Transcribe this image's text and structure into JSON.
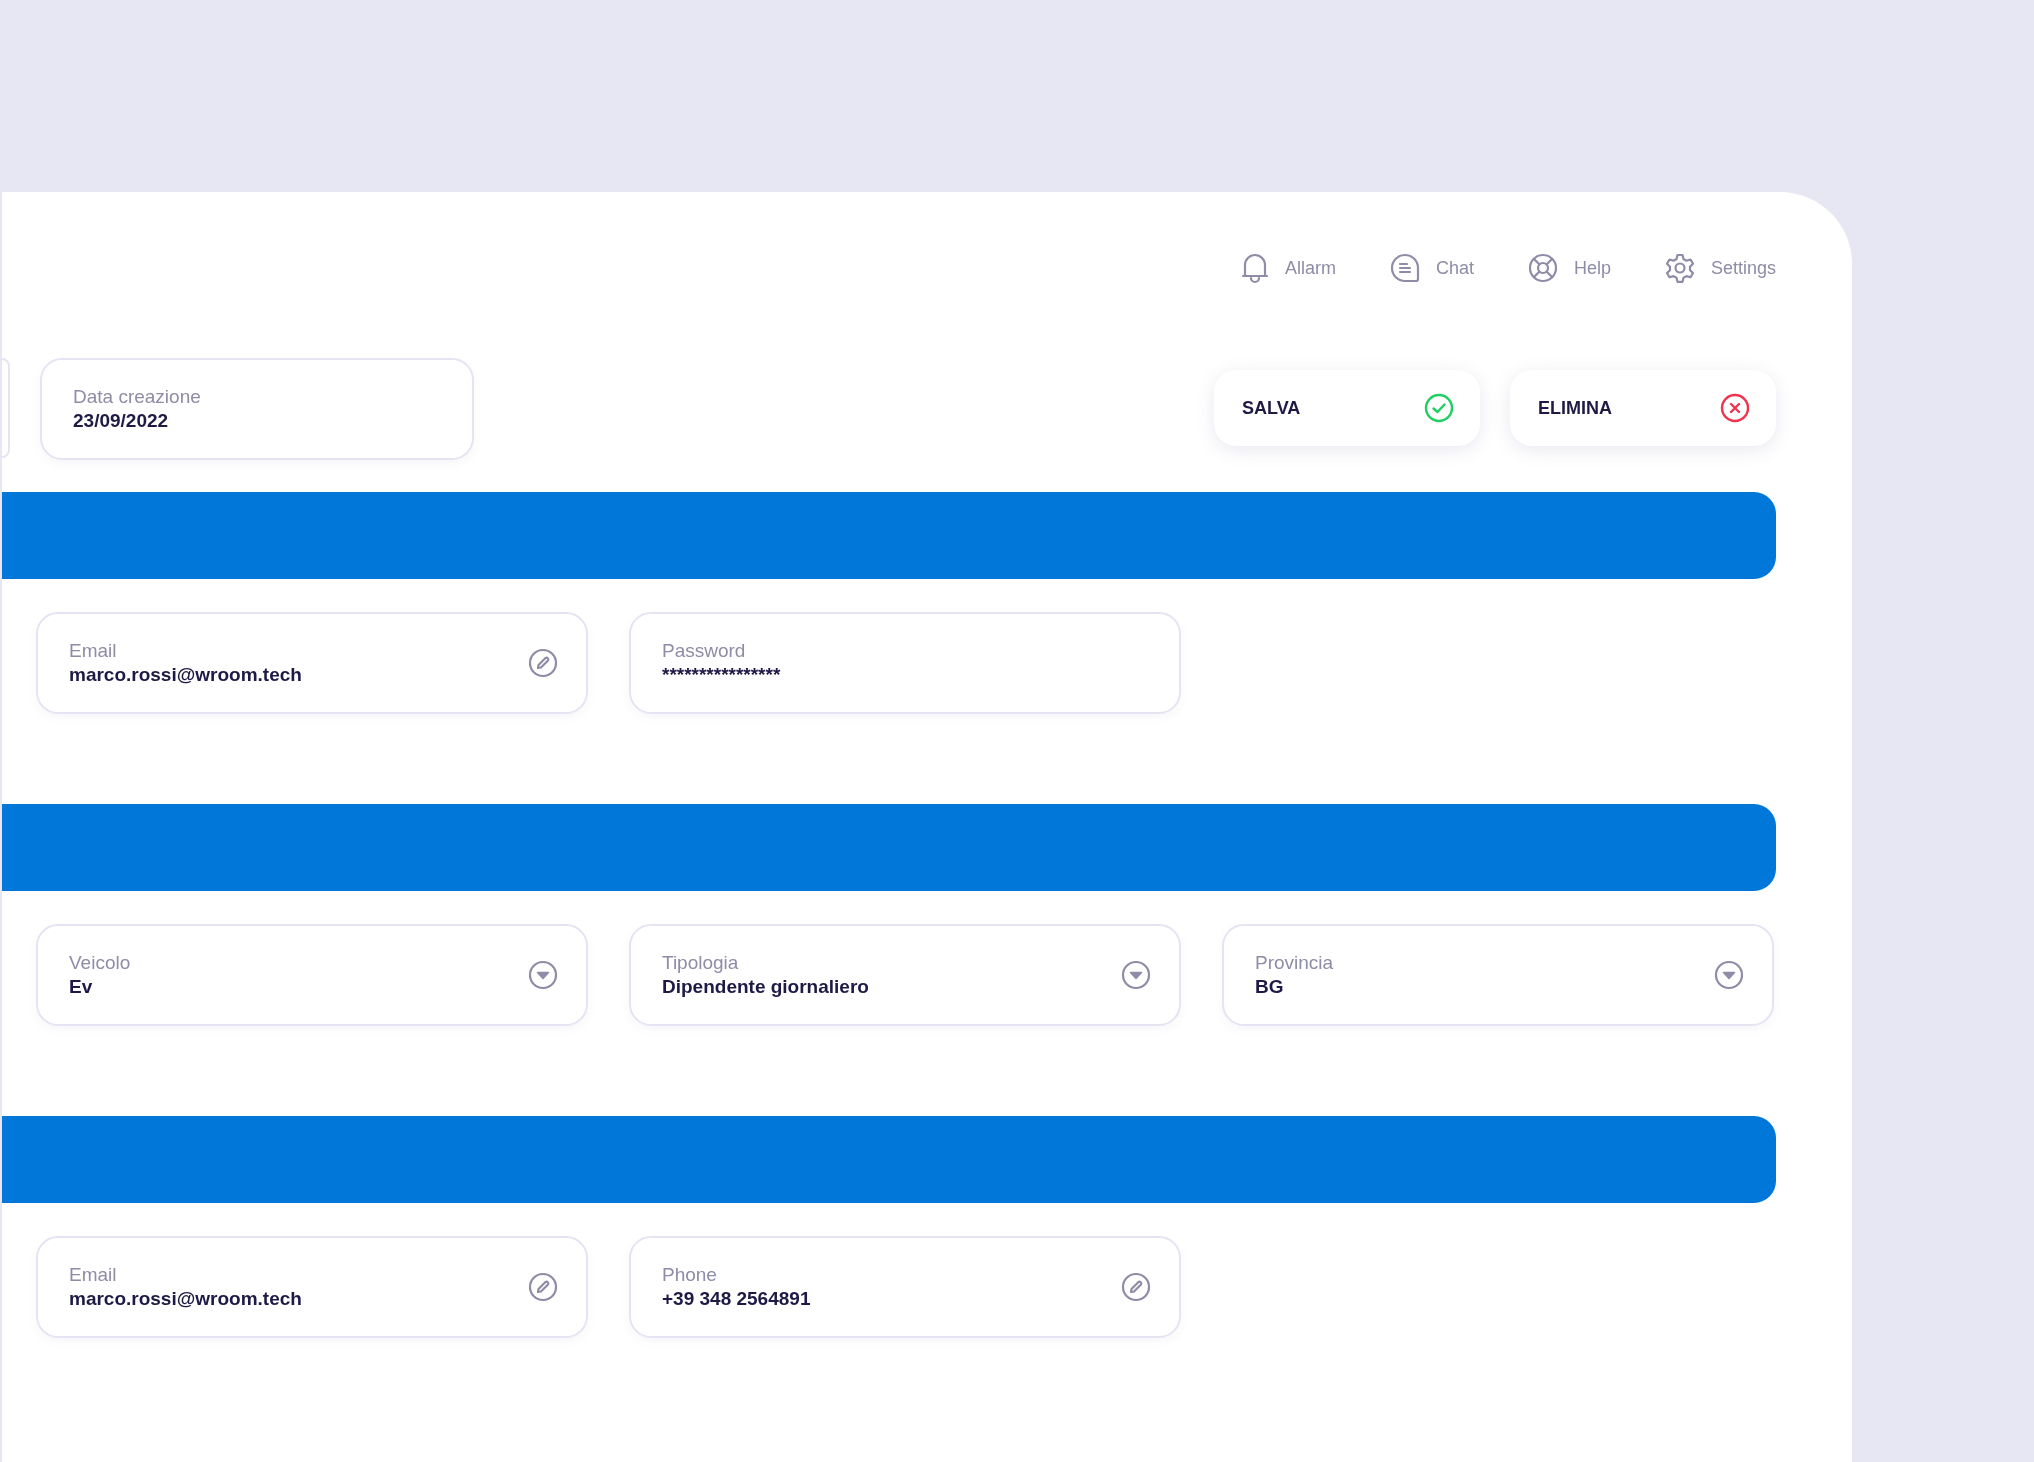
{
  "nav": [
    {
      "label": "Allarm",
      "kind": "bell"
    },
    {
      "label": "Chat",
      "kind": "chat"
    },
    {
      "label": "Help",
      "kind": "help"
    },
    {
      "label": "Settings",
      "kind": "gear"
    }
  ],
  "date_field": {
    "label": "Data creazione",
    "value": "23/09/2022"
  },
  "actions": [
    {
      "label": "SALVA",
      "kind": "save"
    },
    {
      "label": "ELIMINA",
      "kind": "delete"
    }
  ],
  "sections": [
    {
      "fields": [
        {
          "label": "Email",
          "value": "marco.rossi@wroom.tech",
          "kind": "edit"
        },
        {
          "label": "Password",
          "value": "****************",
          "kind": "plain"
        }
      ]
    },
    {
      "fields": [
        {
          "label": "Veicolo",
          "value": "Ev",
          "kind": "select"
        },
        {
          "label": "Tipologia",
          "value": "Dipendente giornaliero",
          "kind": "select"
        },
        {
          "label": "Provincia",
          "value": "BG",
          "kind": "select"
        }
      ]
    },
    {
      "fields": [
        {
          "label": "Email",
          "value": "marco.rossi@wroom.tech",
          "kind": "edit"
        },
        {
          "label": "Phone",
          "value": "+39 348 2564891",
          "kind": "edit"
        }
      ]
    }
  ]
}
